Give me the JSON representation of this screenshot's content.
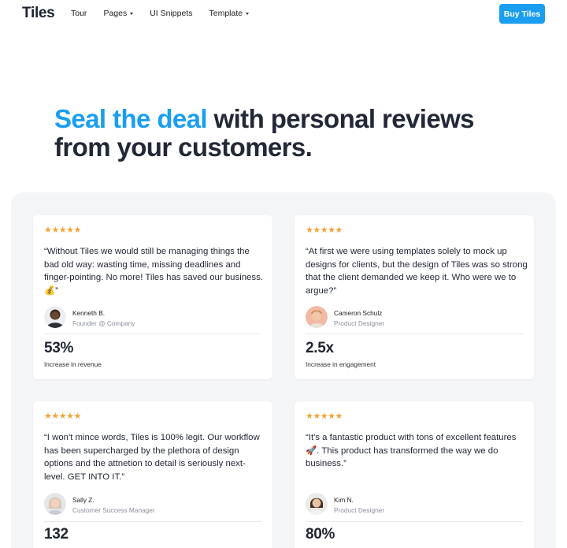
{
  "nav": {
    "logo": "Tiles",
    "links": [
      {
        "label": "Tour"
      },
      {
        "label": "Pages"
      },
      {
        "label": "UI Snippets"
      },
      {
        "label": "Template"
      }
    ],
    "buy_label": "Buy Tiles"
  },
  "hero": {
    "accent": "Seal the deal",
    "rest": "with personal reviews from your customers."
  },
  "colors": {
    "accent": "#1a9ef0",
    "star": "#f0a43a",
    "panel_bg": "#f4f5f7"
  },
  "reviews": [
    {
      "stars": "★★★★★",
      "quote": "“Without Tiles we would still be managing things the bad old way: wasting time, missing deadlines and finger-pointing. No more! Tiles has saved our business. 💰”",
      "name": "Kenneth B.",
      "role": "Founder @ Company",
      "stat": "53%",
      "stat_label": "Increase in revenue"
    },
    {
      "stars": "★★★★★",
      "quote": "“At first we were using templates solely to mock up designs for clients, but the design of Tiles was so strong that the client demanded we keep it. Who were we to argue?”",
      "name": "Cameron Schulz",
      "role": "Product Designer",
      "stat": "2.5x",
      "stat_label": "Increase in engagement"
    },
    {
      "stars": "★★★★★",
      "quote": "“I won't mince words, Tiles is 100% legit. Our workflow has been supercharged by the plethora of design options and the attnetion to detail is seriously next-level. GET INTO IT.”",
      "name": "Sally Z.",
      "role": "Customer Success Manager",
      "stat": "132",
      "stat_label": ""
    },
    {
      "stars": "★★★★★",
      "quote": "“It's a fantastic product with tons of excellent features 🚀. This product has transformed the way we do business.”",
      "name": "Kim N.",
      "role": "Product Designer",
      "stat": "80%",
      "stat_label": ""
    }
  ]
}
